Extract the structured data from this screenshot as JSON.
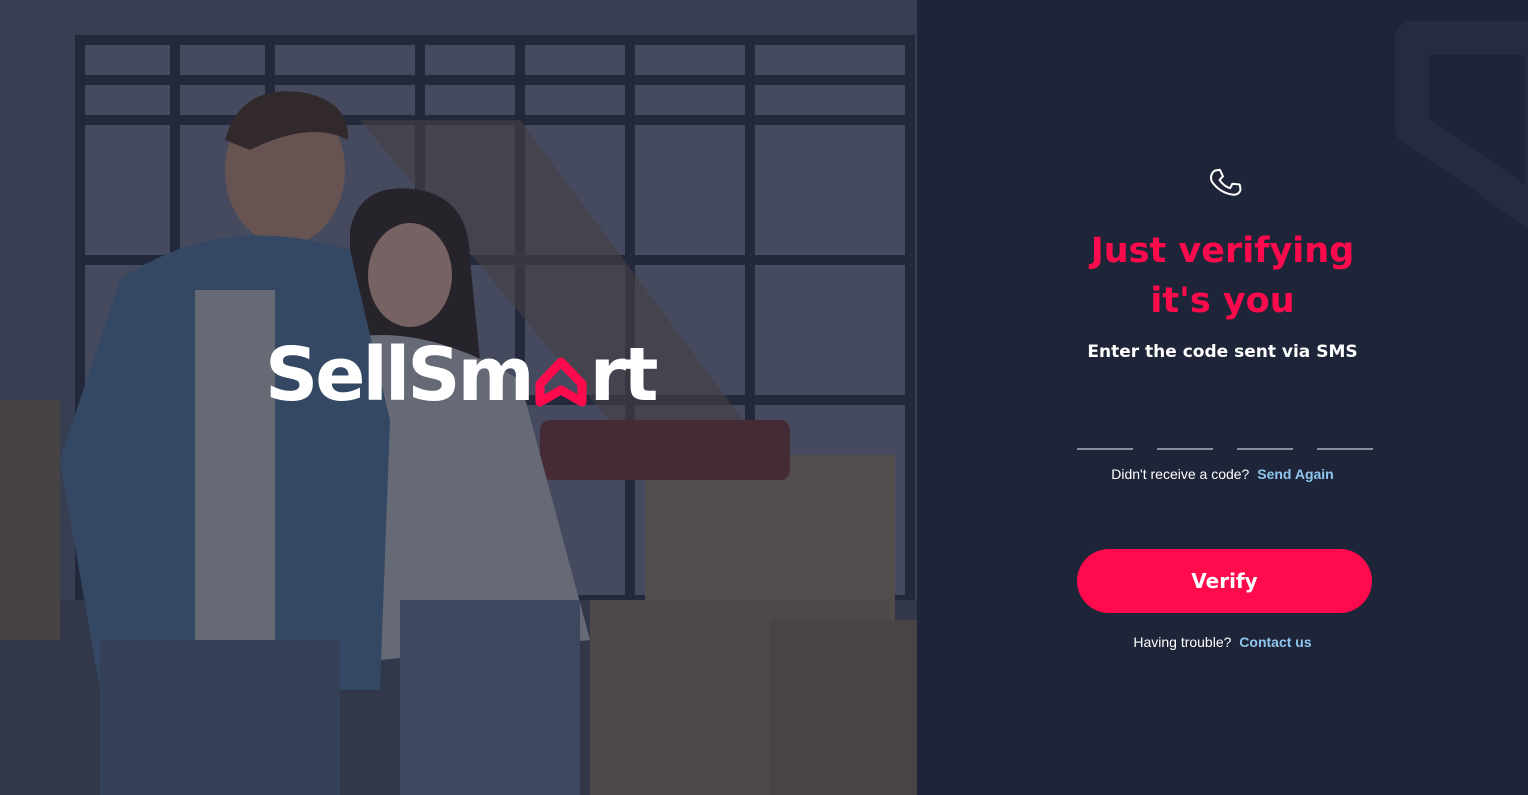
{
  "brand": {
    "name_prefix": "SellSm",
    "name_suffix": "rt",
    "accent_color": "#ff0a4c",
    "panel_color": "#1f2538",
    "link_color": "#8fc6ef"
  },
  "hero": {
    "image_description_icon": "couple-photo"
  },
  "verify": {
    "icon": "phone-icon",
    "title_line1": "Just verifying",
    "title_line2": "it's you",
    "subtitle": "Enter the code sent via SMS",
    "code_fields": [
      "",
      "",
      "",
      ""
    ],
    "resend_prompt": "Didn't receive a code?",
    "resend_link": "Send Again",
    "button_label": "Verify",
    "help_prompt": "Having trouble?",
    "help_link": "Contact us"
  }
}
